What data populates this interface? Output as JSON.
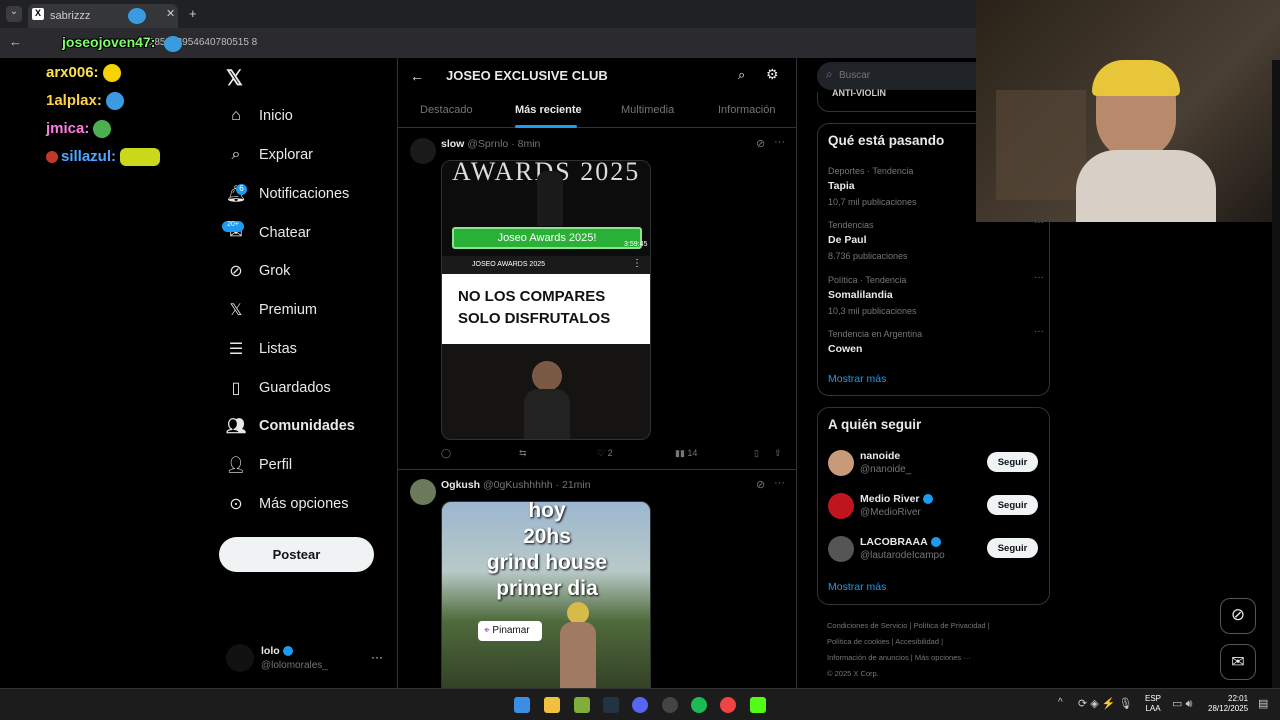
{
  "browser": {
    "tab_title": "sabrizzz",
    "url": "/185103954640780515 8",
    "tab_overlay": "joseojoven47:"
  },
  "stream_chat": [
    {
      "user": "arx006:",
      "color": "#ffe14d"
    },
    {
      "user": "1alplax:",
      "color": "#ffd24a"
    },
    {
      "user": "jmica:",
      "color": "#ff7de0"
    },
    {
      "user": "sillazul:",
      "color": "#4da6ff"
    }
  ],
  "sidebar": {
    "items": [
      {
        "label": "Inicio",
        "icon": "home-icon"
      },
      {
        "label": "Explorar",
        "icon": "search-icon"
      },
      {
        "label": "Notificaciones",
        "icon": "bell-icon"
      },
      {
        "label": "Chatear",
        "icon": "chat-icon"
      },
      {
        "label": "Grok",
        "icon": "grok-icon"
      },
      {
        "label": "Premium",
        "icon": "x-logo-icon"
      },
      {
        "label": "Listas",
        "icon": "list-icon"
      },
      {
        "label": "Guardados",
        "icon": "bookmark-icon"
      },
      {
        "label": "Comunidades",
        "icon": "communities-icon"
      },
      {
        "label": "Perfil",
        "icon": "person-icon"
      },
      {
        "label": "Más opciones",
        "icon": "more-icon"
      }
    ],
    "notif_badge": "6",
    "chat_badge": "20+",
    "post_label": "Postear",
    "account": {
      "name": "lolo",
      "handle": "@lolomorales_"
    }
  },
  "main": {
    "title": "JOSEO EXCLUSIVE CLUB",
    "tabs": [
      "Destacado",
      "Más reciente",
      "Multimedia",
      "Información"
    ],
    "tweets": [
      {
        "name": "slow",
        "handle": "@Sprnlo",
        "time": "· 8min",
        "media": {
          "banner": "Joseo Awards 2025!",
          "duration": "3:59:45",
          "channel": "JOSEO AWARDS 2025",
          "headline1": "NO LOS COMPARES",
          "headline2": "SOLO DISFRUTALOS",
          "top_text": "AWARDS 2025"
        },
        "likes": "2",
        "views": "14"
      },
      {
        "name": "Ogkush",
        "handle": "@0gKushhhhh",
        "time": "· 21min",
        "media": {
          "caption": "hoy\n20hs\ngrind house\nprimer dia",
          "pin": "Pinamar"
        }
      }
    ]
  },
  "right": {
    "search_placeholder": "Buscar",
    "top_peek": "ANTI-VIOLIN",
    "trends_title": "Qué está pasando",
    "trends": [
      {
        "cat": "Deportes · Tendencia",
        "name": "Tapia",
        "count": "10,7 mil publicaciones"
      },
      {
        "cat": "Tendencias",
        "name": "De Paul",
        "count": "8.736 publicaciones"
      },
      {
        "cat": "Política · Tendencia",
        "name": "Somalilandia",
        "count": "10,3 mil publicaciones"
      },
      {
        "cat": "Tendencia en Argentina",
        "name": "Cowen",
        "count": ""
      }
    ],
    "show_more": "Mostrar más",
    "follow_title": "A quién seguir",
    "follow": [
      {
        "name": "nanoide",
        "handle": "@nanoide_",
        "verified": false
      },
      {
        "name": "Medio River",
        "handle": "@MedioRiver",
        "verified": true
      },
      {
        "name": "LACOBRAAA",
        "handle": "@lautarodeIcampo",
        "verified": true
      }
    ],
    "follow_btn": "Seguir",
    "footer": [
      "Condiciones de Servicio",
      "Política de Privacidad",
      "Política de cookies",
      "Accesibilidad",
      "Información de anuncios",
      "Más opciones ···",
      "© 2025 X Corp."
    ]
  },
  "taskbar": {
    "lang1": "ESP",
    "lang2": "LAA",
    "time": "22:01",
    "date": "28/12/2025"
  }
}
